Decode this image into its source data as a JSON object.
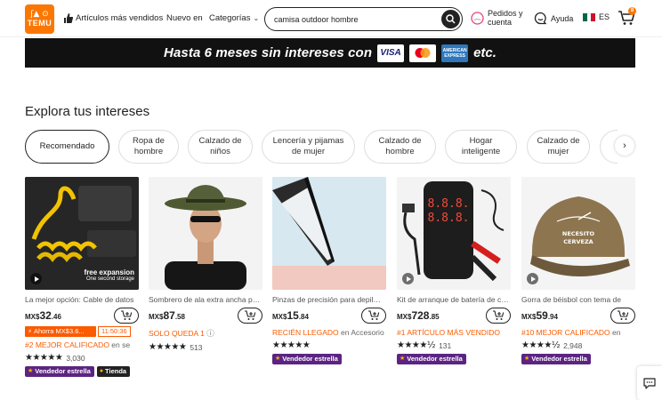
{
  "header": {
    "logo_text": "TEMU",
    "logo_glyphs": "ʃ▲ ⊙",
    "nav": {
      "bestsellers": "Artículos más vendidos",
      "new": "Nuevo en",
      "categories": "Categorías"
    },
    "search": {
      "value": "camisa outdoor hombre",
      "placeholder": ""
    },
    "orders_label": "Pedidos y cuenta",
    "help_label": "Ayuda",
    "language": "ES",
    "cart_count": "8"
  },
  "banner": {
    "text": "Hasta 6 meses sin intereses con",
    "etc": "etc.",
    "card_visa": "VISA",
    "card_amex": "AMERICAN EXPRESS"
  },
  "interests": {
    "title": "Explora tus intereses",
    "chips": [
      "Recomendado",
      "Ropa de hombre",
      "Calzado de niños",
      "Lencería y pijamas de mujer",
      "Calzado de hombre",
      "Hogar inteligente",
      "Calzado de mujer"
    ]
  },
  "products": [
    {
      "title": "La mejor opción: Cable de datos",
      "currency": "MX$",
      "price_int": "32",
      "price_dec": ".46",
      "promo": "Ahorra MX$3.6...",
      "timer": "11:50:36",
      "tag": "#2 MEJOR CALIFICADO",
      "tag_suffix": " en se",
      "stars": "★★★★★",
      "reviews": "3,030",
      "badges": [
        "Vendedor estrella",
        "Tienda"
      ],
      "image_caption_1": "free expansion",
      "image_caption_2": "One second storage"
    },
    {
      "title": "Sombrero de ala extra ancha para",
      "currency": "MX$",
      "price_int": "87",
      "price_dec": ".58",
      "tag": "SOLO QUEDA 1",
      "stars": "★★★★★",
      "reviews": "513"
    },
    {
      "title": "Pinzas de precisión para depilación",
      "currency": "MX$",
      "price_int": "15",
      "price_dec": ".84",
      "tag": "RECIÉN LLEGADO",
      "tag_suffix": " en Accesorios",
      "stars": "★★★★★",
      "reviews": "",
      "badges": [
        "Vendedor estrella"
      ]
    },
    {
      "title": "Kit de arranque de batería de coche",
      "currency": "MX$",
      "price_int": "728",
      "price_dec": ".85",
      "tag": "#1 ARTÍCULO MÁS VENDIDO",
      "stars": "★★★★½",
      "reviews": "131",
      "badges": [
        "Vendedor estrella"
      ],
      "image_caption_1": "8.8.8.",
      "image_caption_2": "8.8.8."
    },
    {
      "title": "Gorra de béisbol con tema de",
      "currency": "MX$",
      "price_int": "59",
      "price_dec": ".94",
      "tag": "#10 MEJOR CALIFICADO",
      "tag_suffix": " en",
      "stars": "★★★★½",
      "reviews": "2,948",
      "badges": [
        "Vendedor estrella"
      ],
      "image_caption_1": "NECESITO",
      "image_caption_2": "CERVEZA"
    }
  ],
  "colors": {
    "brand": "#fb7701",
    "promo": "#fb5b01",
    "badge": "#5c2482",
    "banner": "#111111"
  }
}
